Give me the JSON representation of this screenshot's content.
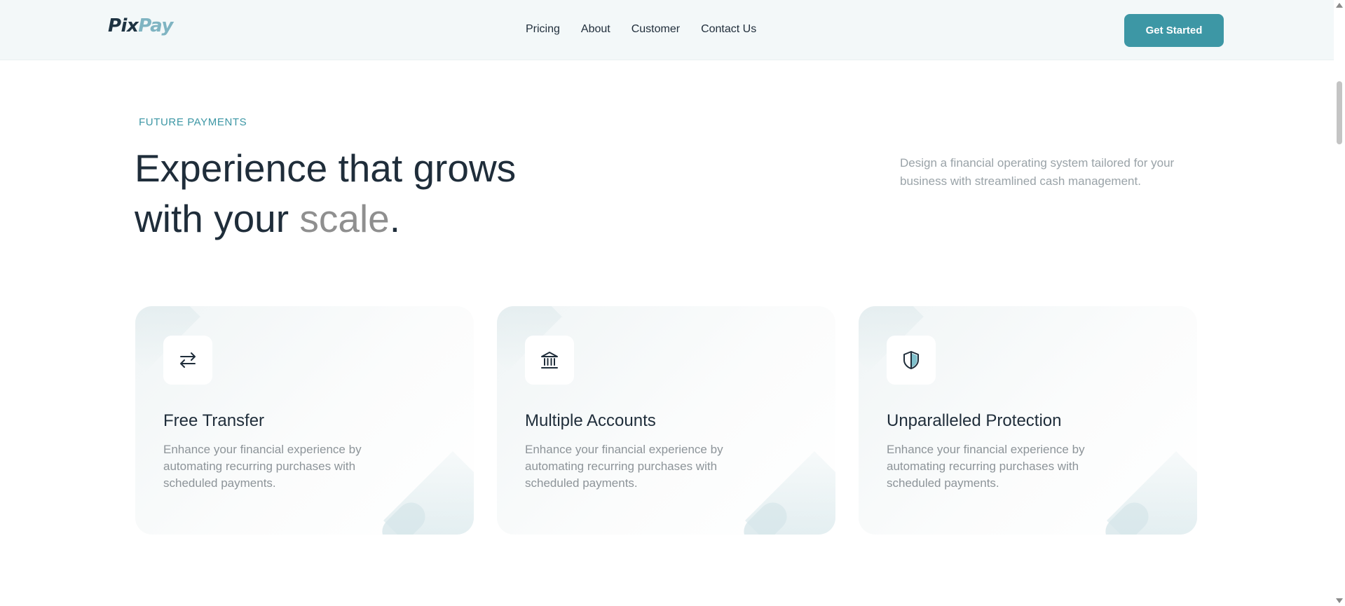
{
  "brand": {
    "part1": "Pix",
    "part2": "Pay"
  },
  "nav": {
    "items": [
      "Pricing",
      "About",
      "Customer",
      "Contact Us"
    ]
  },
  "header": {
    "cta_label": "Get Started"
  },
  "hero": {
    "eyebrow": "FUTURE PAYMENTS",
    "title_line1": "Experience that grows",
    "title_line2_start": "with your ",
    "title_highlight": "scale",
    "title_end": ".",
    "subtitle": "Design a financial operating system tailored for your business with streamlined cash management."
  },
  "features": [
    {
      "icon": "transfer-arrows-icon",
      "title": "Free Transfer",
      "description": "Enhance your financial experience by automating recurring purchases with scheduled payments."
    },
    {
      "icon": "bank-icon",
      "title": "Multiple Accounts",
      "description": "Enhance your financial experience by automating recurring purchases with scheduled payments."
    },
    {
      "icon": "shield-icon",
      "title": "Unparalleled Protection",
      "description": "Enhance your financial experience by automating recurring purchases with scheduled payments."
    }
  ],
  "colors": {
    "accent": "#3d97a5",
    "text": "#1f2d3a",
    "muted": "#8f8f8f",
    "nav_bg": "#f3f8f9"
  }
}
